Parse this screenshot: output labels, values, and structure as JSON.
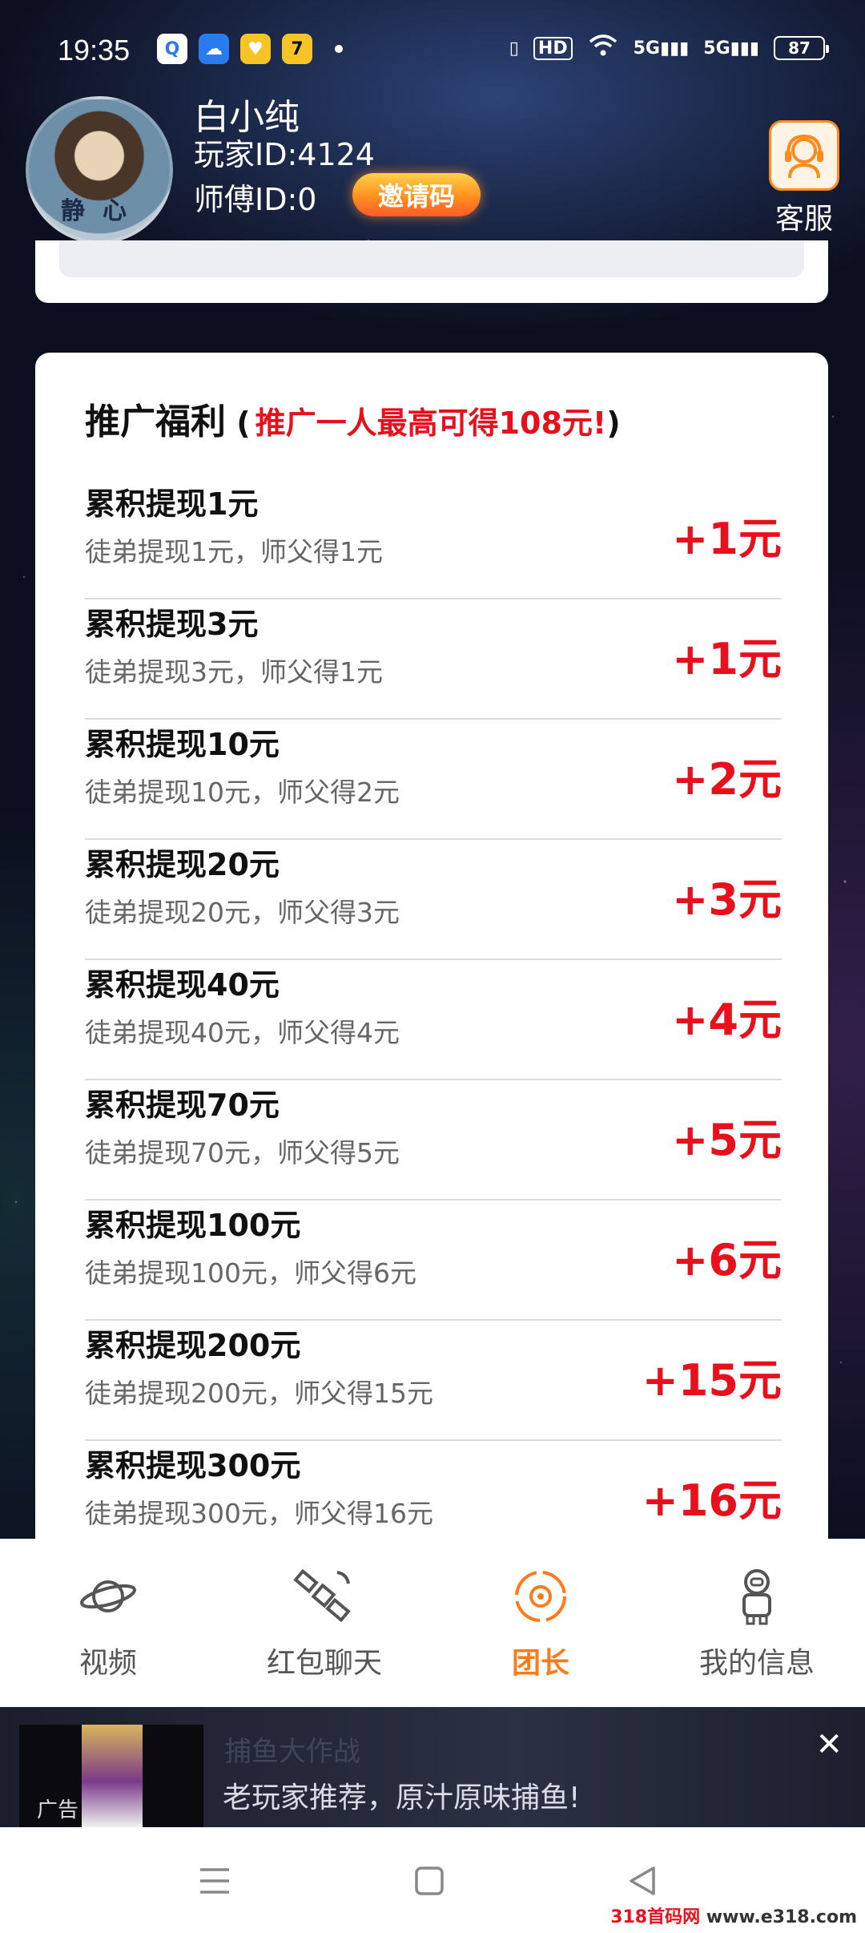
{
  "status_bar": {
    "time": "19:35",
    "battery": "87",
    "hd": "HD",
    "net1": "5G",
    "net2": "5G"
  },
  "profile": {
    "name": "白小纯",
    "player_id": "玩家ID:4124",
    "master_id": "师傅ID:0",
    "invite_label": "邀请码",
    "service_label": "客服"
  },
  "card": {
    "title": "推广福利",
    "paren_open": " (",
    "subtitle": "推广一人最高可得108元!",
    "paren_close": ")"
  },
  "rewards": [
    {
      "title": "累积提现1元",
      "desc": "徒弟提现1元，师父得1元",
      "amount": "+1元"
    },
    {
      "title": "累积提现3元",
      "desc": "徒弟提现3元，师父得1元",
      "amount": "+1元"
    },
    {
      "title": "累积提现10元",
      "desc": "徒弟提现10元，师父得2元",
      "amount": "+2元"
    },
    {
      "title": "累积提现20元",
      "desc": "徒弟提现20元，师父得3元",
      "amount": "+3元"
    },
    {
      "title": "累积提现40元",
      "desc": "徒弟提现40元，师父得4元",
      "amount": "+4元"
    },
    {
      "title": "累积提现70元",
      "desc": "徒弟提现70元，师父得5元",
      "amount": "+5元"
    },
    {
      "title": "累积提现100元",
      "desc": "徒弟提现100元，师父得6元",
      "amount": "+6元"
    },
    {
      "title": "累积提现200元",
      "desc": "徒弟提现200元，师父得15元",
      "amount": "+15元"
    },
    {
      "title": "累积提现300元",
      "desc": "徒弟提现300元，师父得16元",
      "amount": "+16元"
    }
  ],
  "tabs": [
    {
      "label": "视频",
      "icon": "planet-icon",
      "active": false
    },
    {
      "label": "红包聊天",
      "icon": "satellite-icon",
      "active": false
    },
    {
      "label": "团长",
      "icon": "orbit-icon",
      "active": true
    },
    {
      "label": "我的信息",
      "icon": "astronaut-icon",
      "active": false
    }
  ],
  "ad": {
    "tag": "广告",
    "title": "捕鱼大作战",
    "text": "老玩家推荐，原汁原味捕鱼!",
    "close": "✕"
  },
  "watermark": {
    "site": "318首码网",
    "url": "www.e318.com"
  },
  "colors": {
    "accent": "#ff7a1c",
    "reward_red": "#e8101c"
  }
}
